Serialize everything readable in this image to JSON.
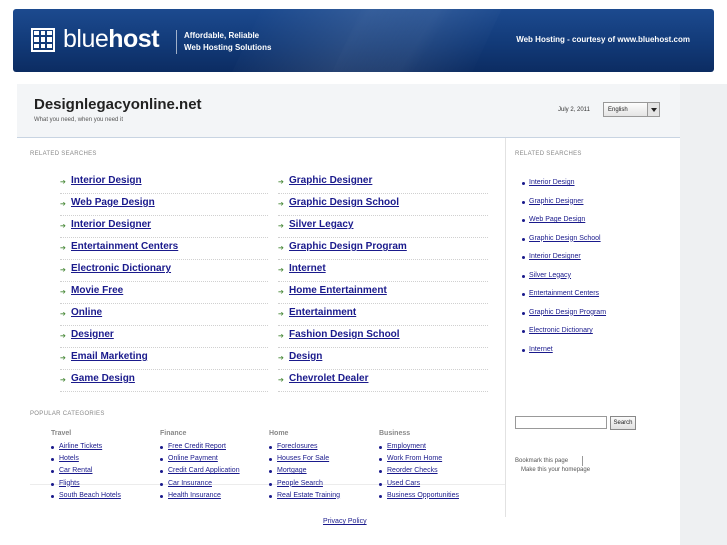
{
  "banner": {
    "logo_light": "blue",
    "logo_bold": "host",
    "tagline_line1": "Affordable, Reliable",
    "tagline_line2": "Web Hosting Solutions",
    "right_text": "Web Hosting - courtesy of www.bluehost.com"
  },
  "site": {
    "title": "Designlegacyonline.net",
    "subtitle": "What you need, when you need it",
    "date": "July 2, 2011",
    "language": "English"
  },
  "related": {
    "label": "RELATED SEARCHES",
    "left": [
      "Interior Design",
      "Web Page Design",
      "Interior Designer",
      "Entertainment Centers",
      "Electronic Dictionary",
      "Movie Free",
      "Online",
      "Designer",
      "Email Marketing",
      "Game Design"
    ],
    "right": [
      "Graphic Designer",
      "Graphic Design School",
      "Silver Legacy",
      "Graphic Design Program",
      "Internet",
      "Home Entertainment",
      "Entertainment",
      "Fashion Design School",
      "Design",
      "Chevrolet Dealer"
    ]
  },
  "sidebar": {
    "label": "RELATED SEARCHES",
    "items": [
      "Interior Design",
      "Graphic Designer",
      "Web Page Design",
      "Graphic Design School",
      "Interior Designer",
      "Silver Legacy",
      "Entertainment Centers",
      "Graphic Design Program",
      "Electronic Dictionary",
      "Internet"
    ]
  },
  "popular": {
    "label": "POPULAR CATEGORIES",
    "categories": [
      {
        "name": "Travel",
        "items": [
          "Airline Tickets",
          "Hotels",
          "Car Rental",
          "Flights",
          "South Beach Hotels"
        ]
      },
      {
        "name": "Finance",
        "items": [
          "Free Credit Report",
          "Online Payment",
          "Credit Card Application",
          "Car Insurance",
          "Health Insurance"
        ]
      },
      {
        "name": "Home",
        "items": [
          "Foreclosures",
          "Houses For Sale",
          "Mortgage",
          "People Search",
          "Real Estate Training"
        ]
      },
      {
        "name": "Business",
        "items": [
          "Employment",
          "Work From Home",
          "Reorder Checks",
          "Used Cars",
          "Business Opportunities"
        ]
      }
    ]
  },
  "search": {
    "button_label": "Search",
    "value": ""
  },
  "bookmark_label": "Bookmark this page",
  "homepage_label": "Make this your homepage",
  "privacy_label": "Privacy Policy"
}
